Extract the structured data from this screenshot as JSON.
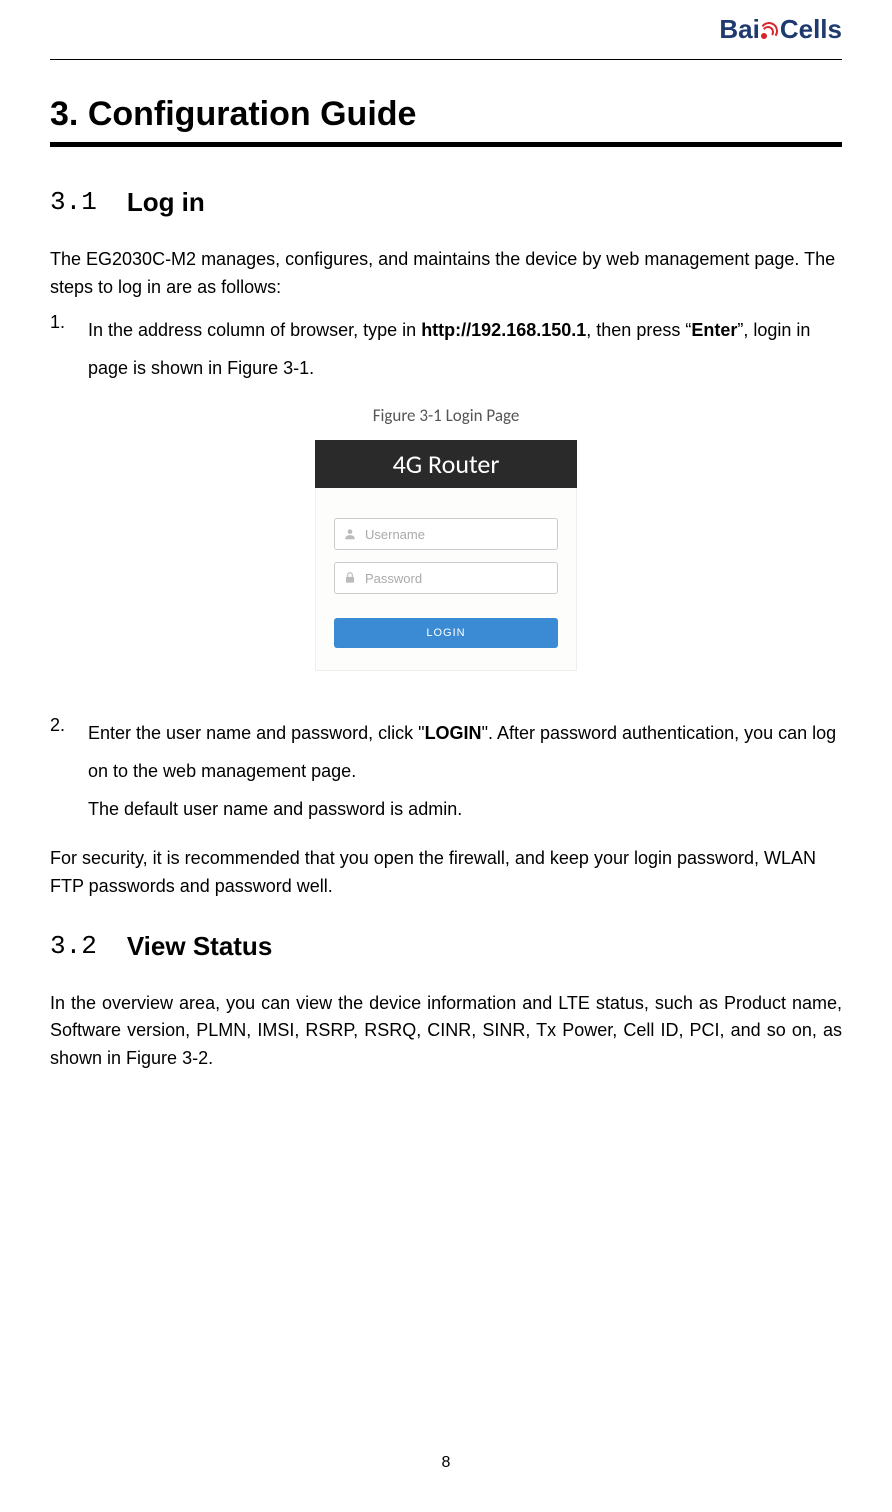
{
  "logo": {
    "part1": "Bai",
    "part2": "Cells"
  },
  "chapter": {
    "number": "3.",
    "title": "Configuration Guide"
  },
  "section31": {
    "number": "3.1",
    "title": "Log in",
    "intro": "The EG2030C-M2 manages, configures, and maintains the device by web management page. The steps to log in are as follows:",
    "step1_pre": "In the address column of browser, type in ",
    "step1_url": "http://192.168.150.1",
    "step1_mid": ", then press “",
    "step1_enter": "Enter",
    "step1_post": "”, login in page is shown in Figure 3-1.",
    "figure_caption": "Figure 3-1 Login Page",
    "step2_pre": "Enter the user name and password, click \"",
    "step2_login": "LOGIN",
    "step2_post": "\". After password authentication, you can log on to the web management page.",
    "step2_note": "The default user name and password is admin.",
    "security": "For security, it is recommended that you open the firewall, and keep your login password, WLAN FTP passwords and password well."
  },
  "login_form": {
    "title": "4G Router",
    "username_placeholder": "Username",
    "password_placeholder": "Password",
    "button": "LOGIN"
  },
  "section32": {
    "number": "3.2",
    "title": "View Status",
    "body": "In the overview area, you can view the device information and LTE status, such as Product name, Software version, PLMN, IMSI, RSRP, RSRQ, CINR, SINR, Tx Power, Cell ID, PCI, and so on, as shown in Figure 3-2."
  },
  "page_number": "8",
  "markers": {
    "one": "1.",
    "two": "2."
  }
}
